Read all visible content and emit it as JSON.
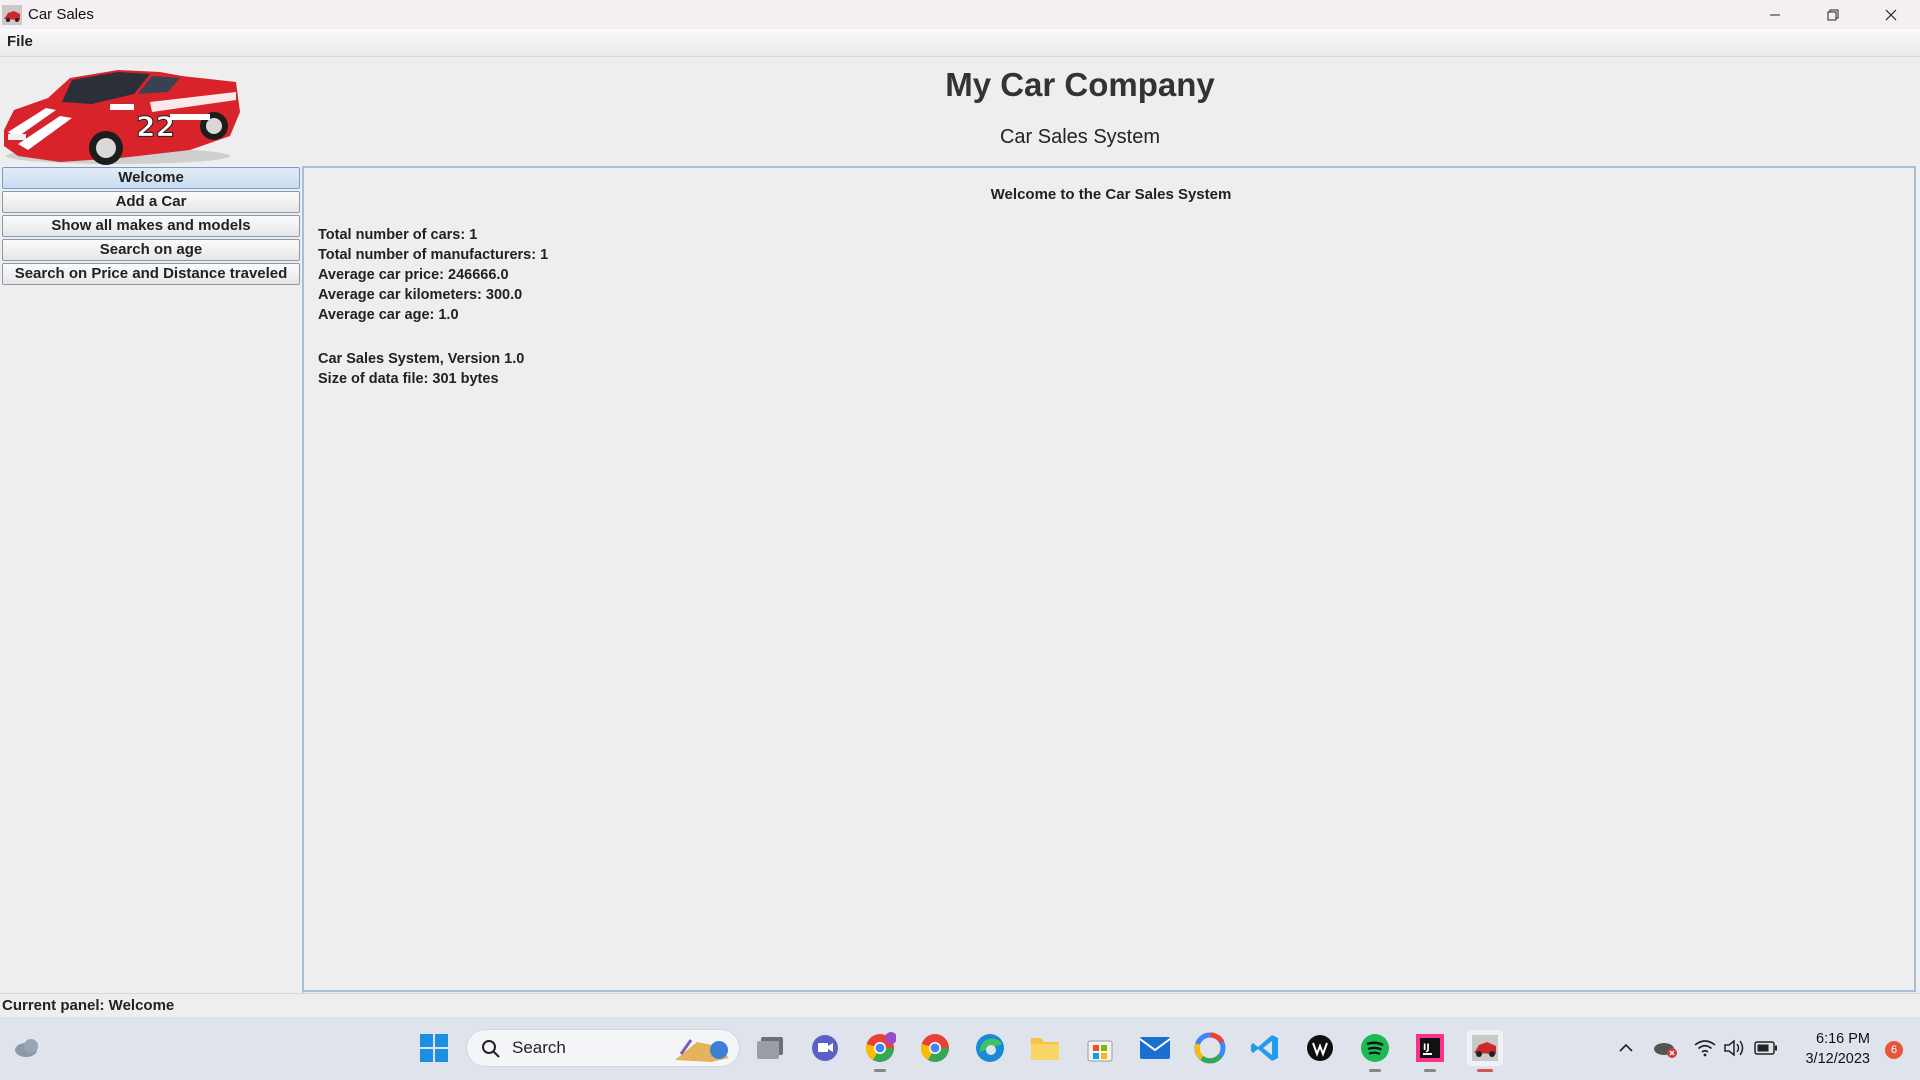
{
  "window": {
    "title": "Car Sales",
    "controls": {
      "minimize_icon": "minimize-icon",
      "maximize_icon": "restore-icon",
      "close_icon": "close-icon"
    }
  },
  "menubar": {
    "file_label": "File"
  },
  "header": {
    "company": "My Car Company",
    "subtitle": "Car Sales System"
  },
  "sidebar": {
    "items": [
      {
        "label": "Welcome",
        "active": true
      },
      {
        "label": "Add a Car",
        "active": false
      },
      {
        "label": "Show all makes and models",
        "active": false
      },
      {
        "label": "Search on age",
        "active": false
      },
      {
        "label": "Search on Price and Distance traveled",
        "active": false
      }
    ]
  },
  "content": {
    "heading": "Welcome to the Car Sales System",
    "stats": [
      "Total number of cars: 1",
      "Total number of manufacturers: 1",
      "Average car price: 246666.0",
      "Average car kilometers: 300.0",
      "Average car age: 1.0"
    ],
    "version": "Car Sales System, Version 1.0",
    "file_size": "Size of data file: 301 bytes"
  },
  "statusbar": {
    "text": "Current panel: Welcome"
  },
  "taskbar": {
    "search_label": "Search",
    "time": "6:16 PM",
    "date": "3/12/2023",
    "notification_count": "6",
    "accent": "#0a5ec8"
  }
}
